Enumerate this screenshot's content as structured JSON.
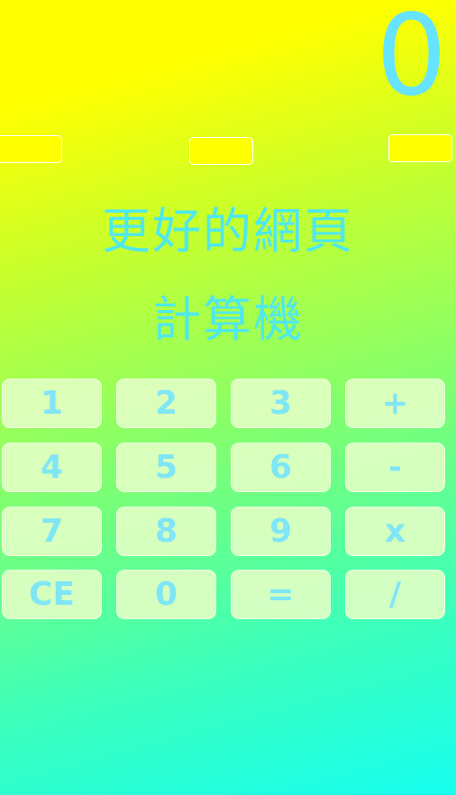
{
  "display": {
    "value": "0"
  },
  "title": {
    "line1": "更好的網頁",
    "line2": "計算機"
  },
  "keys": {
    "k1": "1",
    "k2": "2",
    "k3": "3",
    "plus": "+",
    "k4": "4",
    "k5": "5",
    "k6": "6",
    "minus": "-",
    "k7": "7",
    "k8": "8",
    "k9": "9",
    "multiply": "x",
    "clear": "CE",
    "k0": "0",
    "equals": "=",
    "divide": "/"
  },
  "colors": {
    "gradient_top": "#ffff00",
    "gradient_bottom": "#17fff0",
    "accent_text": "#66e4ff",
    "key_background": "#e2ffc4"
  }
}
